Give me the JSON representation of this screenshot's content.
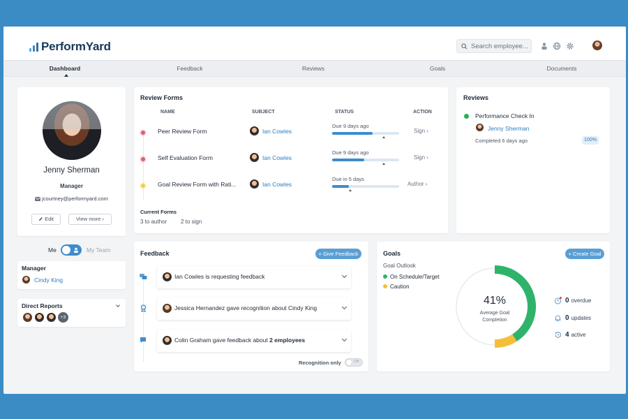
{
  "app": {
    "logo_text": "PerformYard"
  },
  "search": {
    "placeholder": "Search employee..."
  },
  "nav": {
    "tabs": [
      "Dashboard",
      "Feedback",
      "Reviews",
      "Goals",
      "Documents"
    ],
    "active": "Dashboard"
  },
  "profile": {
    "name": "Jenny Sherman",
    "role": "Manager",
    "email": "jcourtney@performyard.com",
    "edit_label": "Edit",
    "view_more_label": "View more"
  },
  "toggle": {
    "me_label": "Me",
    "team_label": "My Team"
  },
  "manager": {
    "heading": "Manager",
    "name": "Cindy King"
  },
  "direct_reports": {
    "heading": "Direct Reports",
    "extra_count": "+3"
  },
  "review_forms": {
    "title": "Review Forms",
    "columns": [
      "NAME",
      "SUBJECT",
      "STATUS",
      "ACTION"
    ],
    "rows": [
      {
        "name": "Peer Review Form",
        "subject": "Ian Cowles",
        "status": "Due 9 days ago",
        "progress": 0.6,
        "action": "Sign",
        "dot_color": "#e35d6a"
      },
      {
        "name": "Self Evaluation Form",
        "subject": "Ian Cowles",
        "status": "Due 9 days ago",
        "progress": 0.48,
        "action": "Sign",
        "dot_color": "#e35d6a"
      },
      {
        "name": "Goal Review Form with Rati...",
        "subject": "Ian Cowles",
        "status": "Due in 5 days",
        "progress": 0.25,
        "action": "Author",
        "dot_color": "#f3cd3c"
      }
    ],
    "current_forms_label": "Current Forms",
    "to_author": "3 to author",
    "to_sign": "2 to sign"
  },
  "reviews": {
    "title": "Reviews",
    "item_title": "Performance Check In",
    "person": "Jenny Sherman",
    "completed": "Completed 6 days ago",
    "percent": "100%"
  },
  "feedback": {
    "title": "Feedback",
    "give_label": "+ Give Feedback",
    "items": [
      {
        "text": "Ian Cowles is requesting feedback"
      },
      {
        "text": "Jessica Hernandez gave recognition about Cindy King"
      },
      {
        "text_prefix": "Colin Graham gave feedback about ",
        "text_bold": "2 employees"
      }
    ],
    "recognition_label": "Recognition only",
    "toggle_state": "Off"
  },
  "goals": {
    "title": "Goals",
    "create_label": "+ Create Goal",
    "outlook_label": "Goal Outlook",
    "legend": [
      {
        "label": "On Schedule/Target",
        "color": "#2fb36b"
      },
      {
        "label": "Caution",
        "color": "#f3bf3a"
      }
    ],
    "completion_percent": "41%",
    "completion_label": "Average Goal Completion",
    "ring": {
      "on_schedule": 0.41,
      "caution": 0.09
    },
    "stats": [
      {
        "count": "0",
        "label": "overdue"
      },
      {
        "count": "0",
        "label": "updates"
      },
      {
        "count": "4",
        "label": "active"
      }
    ]
  },
  "colors": {
    "accent": "#2f7cc1",
    "background": "#3b8cc4",
    "success": "#2fb36b",
    "warning": "#f3bf3a",
    "danger": "#e35d6a"
  }
}
